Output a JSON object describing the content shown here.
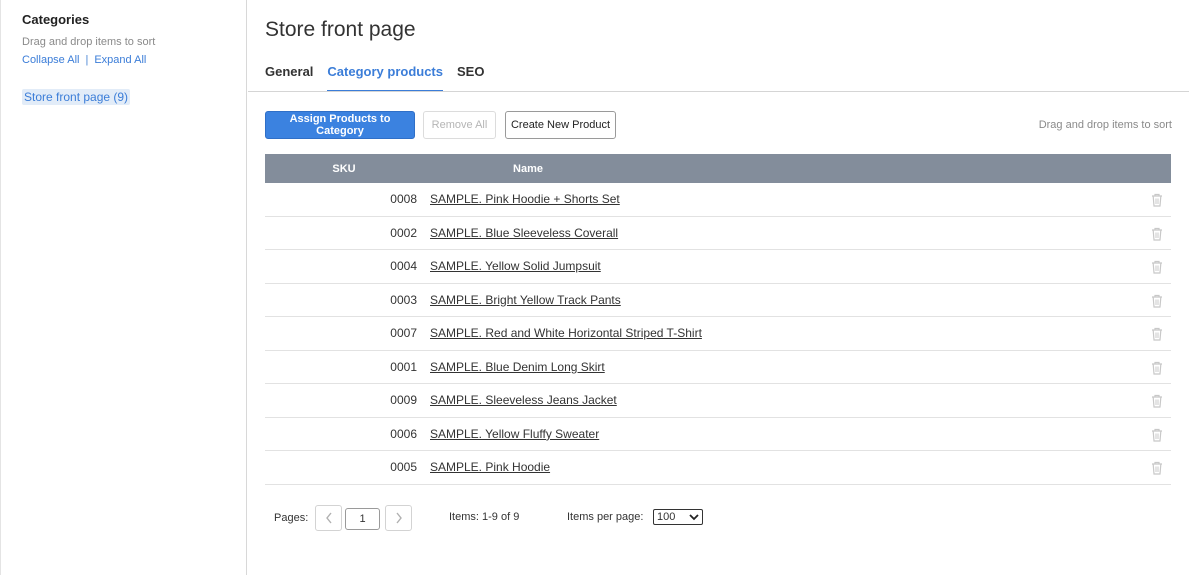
{
  "sidebar": {
    "title": "Categories",
    "hint": "Drag and drop items to sort",
    "collapse_all": "Collapse All",
    "separator": "|",
    "expand_all": "Expand All",
    "tree_item": "Store front page (9)"
  },
  "header": {
    "title": "Store front page",
    "tabs": [
      {
        "label": "General"
      },
      {
        "label": "Category products"
      },
      {
        "label": "SEO"
      }
    ]
  },
  "toolbar": {
    "assign_label": "Assign Products to Category",
    "remove_label": "Remove All",
    "create_label": "Create New Product",
    "drag_hint": "Drag and drop items to sort"
  },
  "table": {
    "headers": {
      "sku": "SKU",
      "name": "Name"
    },
    "rows": [
      {
        "sku": "0008",
        "name": "SAMPLE. Pink Hoodie + Shorts Set"
      },
      {
        "sku": "0002",
        "name": "SAMPLE. Blue Sleeveless Coverall"
      },
      {
        "sku": "0004",
        "name": "SAMPLE. Yellow Solid Jumpsuit"
      },
      {
        "sku": "0003",
        "name": "SAMPLE. Bright Yellow Track Pants"
      },
      {
        "sku": "0007",
        "name": "SAMPLE. Red and White Horizontal Striped T-Shirt"
      },
      {
        "sku": "0001",
        "name": "SAMPLE. Blue Denim Long Skirt"
      },
      {
        "sku": "0009",
        "name": "SAMPLE. Sleeveless Jeans Jacket"
      },
      {
        "sku": "0006",
        "name": "SAMPLE. Yellow Fluffy Sweater"
      },
      {
        "sku": "0005",
        "name": "SAMPLE. Pink Hoodie"
      }
    ]
  },
  "pager": {
    "pages_label": "Pages:",
    "current_page": "1",
    "items_label": "Items:",
    "items_range": "1-9",
    "items_of": "of",
    "items_total": "9",
    "per_page_label": "Items per page:",
    "per_page_value": "100"
  },
  "icons": {
    "trash": "trash-icon",
    "prev": "chevron-left-icon",
    "next": "chevron-right-icon",
    "dropdown": "chevron-down-icon"
  },
  "colors": {
    "accent": "#3b7dd8",
    "primary_button": "#3b82e0",
    "table_header": "#838d9b"
  }
}
